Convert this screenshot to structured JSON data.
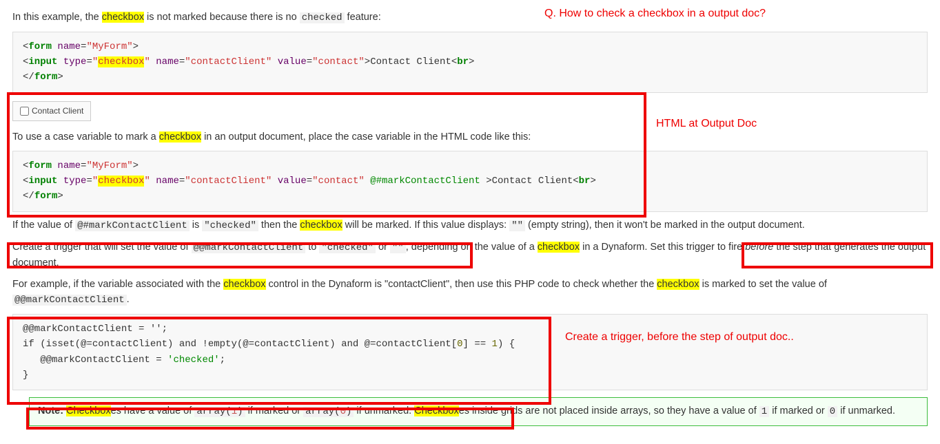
{
  "p1": {
    "t1": "In this example, the ",
    "hl1": "checkbox",
    "t2": " is not marked because there is no ",
    "code1": "checked",
    "t3": " feature:"
  },
  "annot_q": "Q. How to check a checkbox in a output doc?",
  "code1": {
    "form_open_a": "<",
    "form_open_tag": "form",
    "form_name_attr": " name",
    "form_name_eq": "=",
    "form_name_val": "\"MyForm\"",
    "form_open_b": ">",
    "input_a": "<",
    "input_tag": "input",
    "input_type_attr": " type",
    "input_type_eq": "=",
    "input_type_val_q1": "\"",
    "input_type_val_hl": "checkbox",
    "input_type_val_q2": "\"",
    "input_name_attr": " name",
    "input_name_eq": "=",
    "input_name_val": "\"contactClient\"",
    "input_value_attr": " value",
    "input_value_eq": "=",
    "input_value_val": "\"contact\"",
    "input_b": ">",
    "input_text": "Contact Client",
    "br_a": "<",
    "br_tag": "br",
    "br_b": ">",
    "form_close_a": "</",
    "form_close_tag": "form",
    "form_close_b": ">"
  },
  "widget_label": "Contact Client",
  "annot_html": "HTML at Output Doc",
  "p2": {
    "t1": "To use a case variable to mark a ",
    "hl1": "checkbox",
    "t2": " in an output document, place the case variable in the HTML code like this:"
  },
  "code2": {
    "extra_attr": " @#markContactClient ",
    "input_text": "Contact Client"
  },
  "p3": {
    "t1": "If the value of ",
    "c1": "@#markContactClient",
    "t2": " is ",
    "c2": "\"checked\"",
    "t3": " then the ",
    "hl1": "checkbox",
    "t4": " will be marked. If this value displays: ",
    "c3": "\"\"",
    "t5": " (empty string), then it won't be marked in the output document."
  },
  "p4": {
    "t1": "Create a trigger that will set the value of ",
    "c1": "@@markContactClient",
    "t2": " to ",
    "c2": "\"checked\"",
    "t3": " or ",
    "c3": "\"\"",
    "t4": ", depending on the value of a ",
    "hl1": "checkbox",
    "t5": " in a Dynaform. Set this trigger to fire ",
    "em1": "before",
    "t6": " the step that generates the output document."
  },
  "p5": {
    "t1": "For example, if the variable associated with the ",
    "hl1": "checkbox",
    "t2": " control in the Dynaform is \"contactClient\", then use this PHP code to check whether the ",
    "hl2": "checkbox",
    "t3": " is marked to set the value of ",
    "c1": "@@markContactClient",
    "t4": "."
  },
  "annot_trigger": "Create a trigger, before the step of output doc..",
  "code3": {
    "l1": "@@markContactClient = '';",
    "l2a": "if (isset(@=contactClient) and !empty(@=contactClient) and @=contactClient[",
    "l2num": "0",
    "l2b": "] == ",
    "l2num2": "1",
    "l2c": ") {",
    "l3a": "   @@markContactClient = ",
    "l3str": "'checked'",
    "l3b": ";",
    "l4": "}"
  },
  "note": {
    "label": "Note:",
    "sp": " ",
    "hl1": "Checkbox",
    "t1": "es have a value of ",
    "c1a": "array(",
    "c1n": "1",
    "c1b": ")",
    "t2": " if marked or ",
    "c2a": "array(",
    "c2n": "0",
    "c2b": ")",
    "t3": " if unmarked. ",
    "hl2": "Checkbox",
    "t4": "es inside grids are not placed inside arrays, so they have a value of ",
    "c3": "1",
    "t5": " if marked or ",
    "c4": "0",
    "t6": " if unmarked."
  }
}
